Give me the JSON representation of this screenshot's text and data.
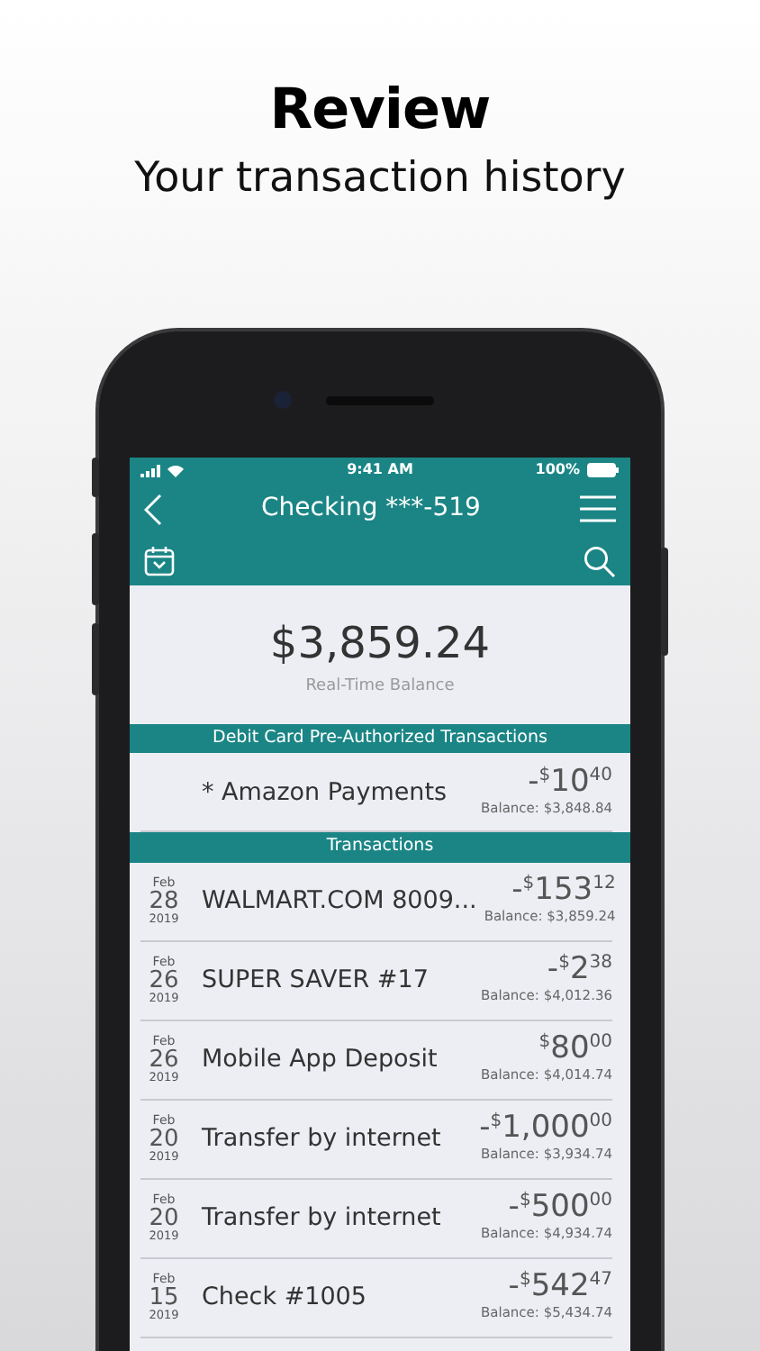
{
  "heading": "Review",
  "subheading": "Your transaction history",
  "status_bar": {
    "time": "9:41 AM",
    "battery": "100%"
  },
  "header": {
    "title": "Checking ***-519"
  },
  "balance": {
    "amount": "$3,859.24",
    "label": "Real-Time Balance"
  },
  "sections": [
    {
      "title": "Debit Card Pre-Authorized Transactions",
      "rows": [
        {
          "name": "* Amazon Payments",
          "sign": "-",
          "currency": "$",
          "dollars": "10",
          "cents": "40",
          "balance": "Balance: $3,848.84"
        }
      ]
    },
    {
      "title": "Transactions",
      "rows": [
        {
          "month": "Feb",
          "day": "28",
          "year": "2019",
          "name": "WALMART.COM 8009...",
          "sign": "-",
          "currency": "$",
          "dollars": "153",
          "cents": "12",
          "balance": "Balance: $3,859.24"
        },
        {
          "month": "Feb",
          "day": "26",
          "year": "2019",
          "name": "SUPER SAVER #17",
          "sign": "-",
          "currency": "$",
          "dollars": "2",
          "cents": "38",
          "balance": "Balance: $4,012.36"
        },
        {
          "month": "Feb",
          "day": "26",
          "year": "2019",
          "name": "Mobile App Deposit",
          "sign": "",
          "currency": "$",
          "dollars": "80",
          "cents": "00",
          "balance": "Balance: $4,014.74"
        },
        {
          "month": "Feb",
          "day": "20",
          "year": "2019",
          "name": "Transfer by internet",
          "sign": "-",
          "currency": "$",
          "dollars": "1,000",
          "cents": "00",
          "balance": "Balance: $3,934.74"
        },
        {
          "month": "Feb",
          "day": "20",
          "year": "2019",
          "name": "Transfer by internet",
          "sign": "-",
          "currency": "$",
          "dollars": "500",
          "cents": "00",
          "balance": "Balance: $4,934.74"
        },
        {
          "month": "Feb",
          "day": "15",
          "year": "2019",
          "name": "Check #1005",
          "sign": "-",
          "currency": "$",
          "dollars": "542",
          "cents": "47",
          "balance": "Balance: $5,434.74"
        }
      ]
    }
  ]
}
